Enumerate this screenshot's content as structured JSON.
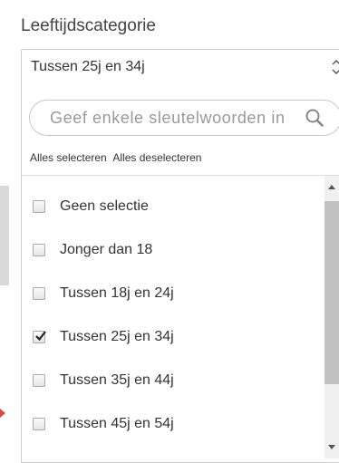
{
  "field": {
    "label": "Leeftijdscategorie",
    "selected_value": "Tussen 25j en 34j",
    "toggle_icon": "updown-chevron-icon"
  },
  "search": {
    "placeholder": "Geef enkele sleutelwoorden in",
    "value": "",
    "icon": "search-icon"
  },
  "bulk_actions": {
    "select_all": "Alles selecteren",
    "deselect_all": "Alles deselecteren"
  },
  "options": [
    {
      "label": "Geen selectie",
      "checked": false
    },
    {
      "label": "Jonger dan 18",
      "checked": false
    },
    {
      "label": "Tussen 18j en 24j",
      "checked": false
    },
    {
      "label": "Tussen 25j en 34j",
      "checked": true
    },
    {
      "label": "Tussen 35j en 44j",
      "checked": false
    },
    {
      "label": "Tussen 45j en 54j",
      "checked": false
    }
  ],
  "colors": {
    "border": "#cfcfcf",
    "scroll_thumb": "#c1c1c1",
    "edge_marker": "#e0463a"
  }
}
